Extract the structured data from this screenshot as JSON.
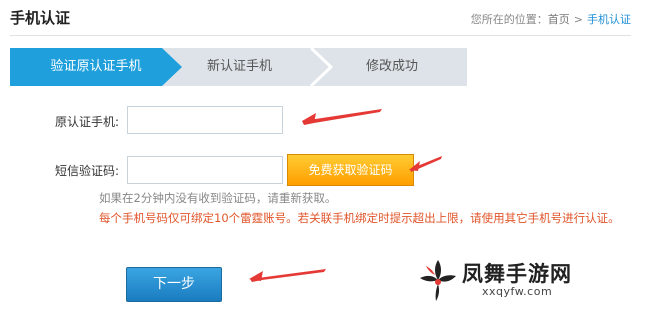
{
  "header": {
    "title": "手机认证",
    "breadcrumb": {
      "prefix": "您所在的位置：",
      "home": "首页",
      "separator": ">",
      "current": "手机认证"
    }
  },
  "steps": [
    {
      "label": "验证原认证手机",
      "state": "active"
    },
    {
      "label": "新认证手机",
      "state": "pending"
    },
    {
      "label": "修改成功",
      "state": "pending"
    }
  ],
  "form": {
    "old_phone_label": "原认证手机:",
    "old_phone_value": "",
    "code_label": "短信验证码:",
    "code_value": "",
    "get_code_button": "免费获取验证码",
    "hint": "如果在2分钟内没有收到验证码，请重新获取。",
    "warning": "每个手机号码仅可绑定10个雷霆账号。若关联手机绑定时提示超出上限，请使用其它手机号进行认证。",
    "next_button": "下一步"
  },
  "watermark": {
    "name": "凤舞手游网",
    "url": "xxqyfw.com"
  },
  "colors": {
    "active_step": "#1f9fdc",
    "step_bar": "#dde3e8",
    "orange_button": "#ff9e00",
    "blue_button": "#1a7cc0",
    "warning_text": "#e0552a",
    "arrow": "#e53935",
    "breadcrumb_current": "#1f8fd6"
  }
}
